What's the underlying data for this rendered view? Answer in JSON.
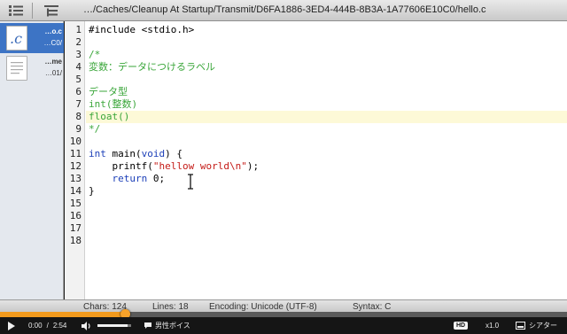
{
  "toolbar": {
    "path": "…/Caches/Cleanup At Startup/Transmit/D6FA1886-3ED4-444B-8B3A-1A77606E10C0/hello.c"
  },
  "sidebar": {
    "files": [
      {
        "name": "…o.c",
        "path": "…C0/",
        "icon": "c-source-file-icon",
        "glyph": ".c"
      },
      {
        "name": "…me",
        "path": "…01/",
        "icon": "document-file-icon",
        "glyph": ""
      }
    ]
  },
  "editor": {
    "line_numbers": [
      "1",
      "2",
      "3",
      "4",
      "5",
      "6",
      "7",
      "8",
      "9",
      "10",
      "11",
      "12",
      "13",
      "14",
      "15",
      "16",
      "17",
      "18"
    ],
    "highlighted_line": 8,
    "lines": [
      [
        {
          "t": "plain",
          "v": "#include <stdio.h>"
        }
      ],
      [],
      [
        {
          "t": "comment",
          "v": "/*"
        }
      ],
      [
        {
          "t": "comment",
          "v": "変数：データにつけるラベル"
        }
      ],
      [],
      [
        {
          "t": "comment",
          "v": "データ型"
        }
      ],
      [
        {
          "t": "comment",
          "v": "int(整数)"
        }
      ],
      [
        {
          "t": "comment",
          "v": "float()"
        }
      ],
      [
        {
          "t": "comment",
          "v": "*/"
        }
      ],
      [],
      [
        {
          "t": "kw",
          "v": "int"
        },
        {
          "t": "plain",
          "v": " main("
        },
        {
          "t": "kw",
          "v": "void"
        },
        {
          "t": "plain",
          "v": ") {"
        }
      ],
      [
        {
          "t": "plain",
          "v": "    printf("
        },
        {
          "t": "str",
          "v": "\"hellow world\\n\""
        },
        {
          "t": "plain",
          "v": ");"
        }
      ],
      [
        {
          "t": "plain",
          "v": "    "
        },
        {
          "t": "kw",
          "v": "return"
        },
        {
          "t": "plain",
          "v": " 0;"
        }
      ],
      [
        {
          "t": "plain",
          "v": "}"
        }
      ],
      [],
      [],
      [],
      []
    ]
  },
  "status": {
    "chars": "Chars: 124",
    "lines": "Lines: 18",
    "encoding": "Encoding: Unicode (UTF-8)",
    "syntax": "Syntax: C"
  },
  "player": {
    "current_time": "0:00",
    "separator": "/",
    "duration": "2:54",
    "progress_fraction": 0.22,
    "volume_fraction": 0.9,
    "voice_label": "男性ボイス",
    "hd_label": "HD",
    "speed_label": "x1.0",
    "theater_label": "シアター"
  },
  "colors": {
    "accent": "#f29a1d",
    "selection": "#3d74c5",
    "comment": "#3aa63a",
    "keyword": "#1c3fb8",
    "string": "#c41a16"
  }
}
